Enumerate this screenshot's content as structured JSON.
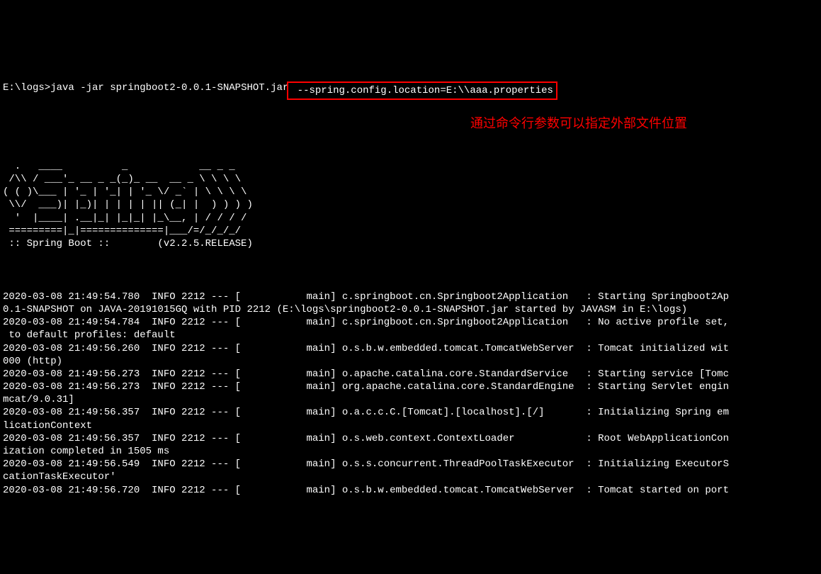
{
  "prompt": {
    "path": "E:\\logs>",
    "command_pre": "java -jar springboot2-0.0.1-SNAPSHOT.jar",
    "command_highlighted": " --spring.config.location=E:\\\\aaa.properties"
  },
  "annotation": "通过命令行参数可以指定外部文件位置",
  "ascii_art": "  .   ____          _            __ _ _\n /\\\\ / ___'_ __ _ _(_)_ __  __ _ \\ \\ \\ \\\n( ( )\\___ | '_ | '_| | '_ \\/ _` | \\ \\ \\ \\\n \\\\/  ___)| |_)| | | | | || (_| |  ) ) ) )\n  '  |____| .__|_| |_|_| |_\\__, | / / / /\n =========|_|==============|___/=/_/_/_/\n :: Spring Boot ::        (v2.2.5.RELEASE)",
  "log_lines": [
    "",
    "2020-03-08 21:49:54.780  INFO 2212 --- [           main] c.springboot.cn.Springboot2Application   : Starting Springboot2Ap",
    "0.1-SNAPSHOT on JAVA-20191015GQ with PID 2212 (E:\\logs\\springboot2-0.0.1-SNAPSHOT.jar started by JAVASM in E:\\logs)",
    "2020-03-08 21:49:54.784  INFO 2212 --- [           main] c.springboot.cn.Springboot2Application   : No active profile set,",
    " to default profiles: default",
    "2020-03-08 21:49:56.260  INFO 2212 --- [           main] o.s.b.w.embedded.tomcat.TomcatWebServer  : Tomcat initialized wit",
    "000 (http)",
    "2020-03-08 21:49:56.273  INFO 2212 --- [           main] o.apache.catalina.core.StandardService   : Starting service [Tomc",
    "2020-03-08 21:49:56.273  INFO 2212 --- [           main] org.apache.catalina.core.StandardEngine  : Starting Servlet engin",
    "mcat/9.0.31]",
    "2020-03-08 21:49:56.357  INFO 2212 --- [           main] o.a.c.c.C.[Tomcat].[localhost].[/]       : Initializing Spring em",
    "licationContext",
    "2020-03-08 21:49:56.357  INFO 2212 --- [           main] o.s.web.context.ContextLoader            : Root WebApplicationCon",
    "ization completed in 1505 ms",
    "2020-03-08 21:49:56.549  INFO 2212 --- [           main] o.s.s.concurrent.ThreadPoolTaskExecutor  : Initializing ExecutorS",
    "cationTaskExecutor'",
    "2020-03-08 21:49:56.720  INFO 2212 --- [           main] o.s.b.w.embedded.tomcat.TomcatWebServer  : Tomcat started on port"
  ]
}
